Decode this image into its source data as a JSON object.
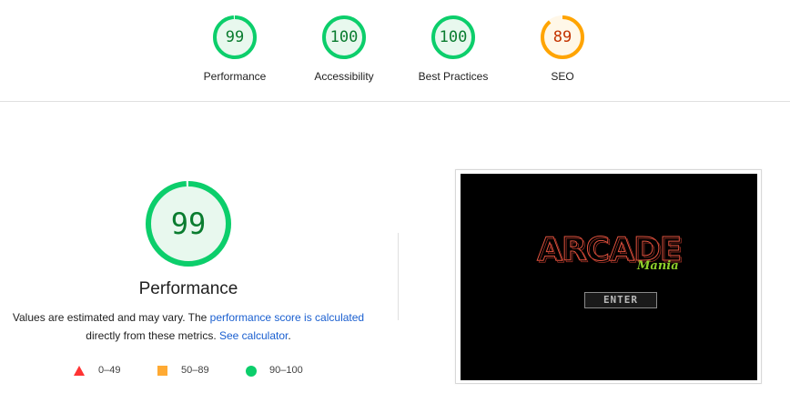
{
  "categories": [
    {
      "label": "Performance",
      "score": "99",
      "fraction": 0.99,
      "color": "#0cce6b",
      "fill": "#e8f8ee",
      "text_color": "#0a7c2f"
    },
    {
      "label": "Accessibility",
      "score": "100",
      "fraction": 1.0,
      "color": "#0cce6b",
      "fill": "#e8f8ee",
      "text_color": "#0a7c2f"
    },
    {
      "label": "Best Practices",
      "score": "100",
      "fraction": 1.0,
      "color": "#0cce6b",
      "fill": "#e8f8ee",
      "text_color": "#0a7c2f"
    },
    {
      "label": "SEO",
      "score": "89",
      "fraction": 0.89,
      "color": "#ffa400",
      "fill": "#fff7e8",
      "text_color": "#c33300"
    }
  ],
  "main": {
    "score": "99",
    "fraction": 0.99,
    "title": "Performance",
    "desc_part1": "Values are estimated and may vary. The ",
    "desc_link1": "performance score is calculated",
    "desc_part2": "directly from these metrics. ",
    "desc_link2": "See calculator",
    "desc_part3": "."
  },
  "legend": [
    {
      "icon": "triangle-icon",
      "label": "0–49",
      "color": "#ff3333"
    },
    {
      "icon": "square-icon",
      "label": "50–89",
      "color": "#ffaa33"
    },
    {
      "icon": "circle-icon",
      "label": "90–100",
      "color": "#0cce6b"
    }
  ],
  "screenshot": {
    "logo_text": "ARCADE",
    "logo_script": "Mania",
    "enter_label": "ENTER"
  }
}
